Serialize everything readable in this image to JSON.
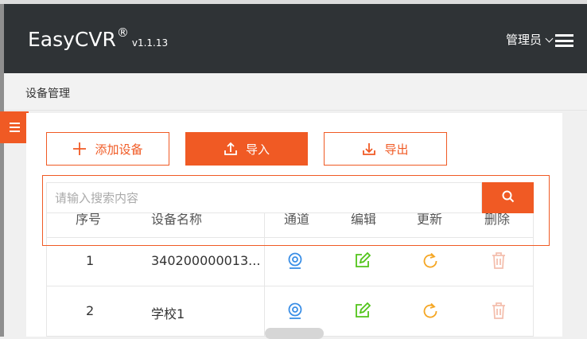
{
  "brand": {
    "name": "EasyCVR",
    "reg": "®",
    "version": "v1.1.13"
  },
  "header": {
    "user_label": "管理员"
  },
  "breadcrumb": {
    "label": "设备管理"
  },
  "toolbar": {
    "add_label": "添加设备",
    "import_label": "导入",
    "export_label": "导出"
  },
  "search": {
    "placeholder": "请输入搜索内容",
    "value": ""
  },
  "table": {
    "columns": [
      "序号",
      "设备名称",
      "通道",
      "编辑",
      "更新",
      "删除"
    ],
    "rows": [
      {
        "index": "1",
        "name": "340200000013..."
      },
      {
        "index": "2",
        "name": "学校1"
      }
    ]
  },
  "colors": {
    "accent": "#f05a24",
    "header_bg": "#2f3336",
    "channel_icon": "#3a8ee6",
    "edit_icon": "#52c41a",
    "refresh_icon": "#f5a623",
    "delete_icon": "#f4bfae"
  },
  "icons": {
    "channel": "webcam-icon",
    "edit": "edit-icon",
    "refresh": "refresh-icon",
    "delete": "trash-icon"
  }
}
